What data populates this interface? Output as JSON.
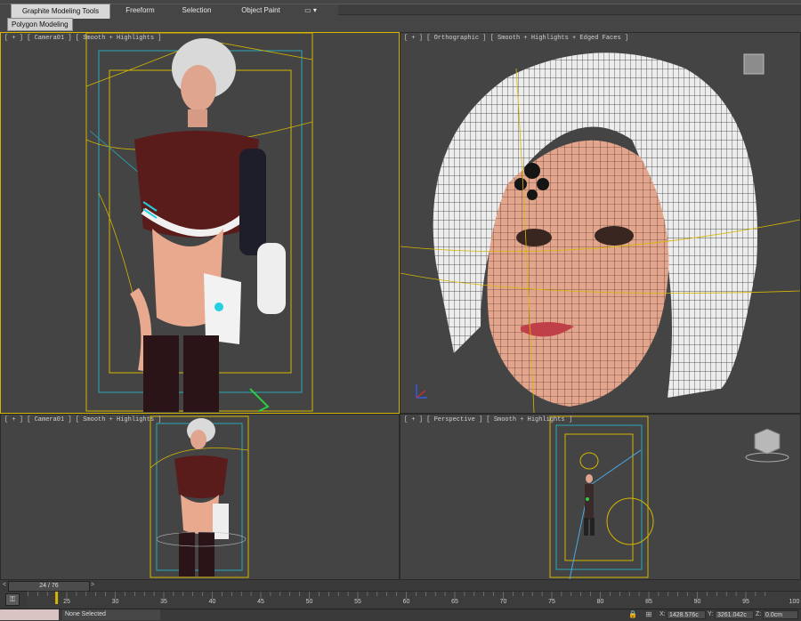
{
  "ribbon": {
    "tabs": [
      {
        "label": "Graphite Modeling Tools",
        "active": true
      },
      {
        "label": "Freeform",
        "active": false
      },
      {
        "label": "Selection",
        "active": false
      },
      {
        "label": "Object Paint",
        "active": false
      }
    ],
    "extra_icon": "toggle-ribbon-icon",
    "panel_button": "Polygon Modeling"
  },
  "viewports": [
    {
      "label": "[ + ] [ Camera01 ] [ Smooth + Highlights ]",
      "active": true
    },
    {
      "label": "[ + ] [ Orthographic ] [ Smooth + Highlights + Edged Faces ]",
      "active": false
    },
    {
      "label": "[ + ] [ Camera01 ] [ Smooth + Highlights ]",
      "active": false
    },
    {
      "label": "[ + ] [ Perspective ] [ Smooth + Highlights ]",
      "active": false
    }
  ],
  "timeline": {
    "frame_counter": "24 / 76",
    "ticks": [
      "25",
      "30",
      "35",
      "40",
      "45",
      "50",
      "55",
      "60",
      "65",
      "70",
      "75",
      "80",
      "85",
      "90",
      "95",
      "100"
    ]
  },
  "status": {
    "selection": "None Selected",
    "x_label": "X:",
    "x_value": "1428.576c",
    "y_label": "Y:",
    "y_value": "3261.042c",
    "z_label": "Z:",
    "z_value": "0.0cm"
  },
  "colors": {
    "viewport_bg": "#444444",
    "active_border": "#d6b600",
    "camera_frame": "#d6b600",
    "safe_frame": "#27a9b8"
  }
}
